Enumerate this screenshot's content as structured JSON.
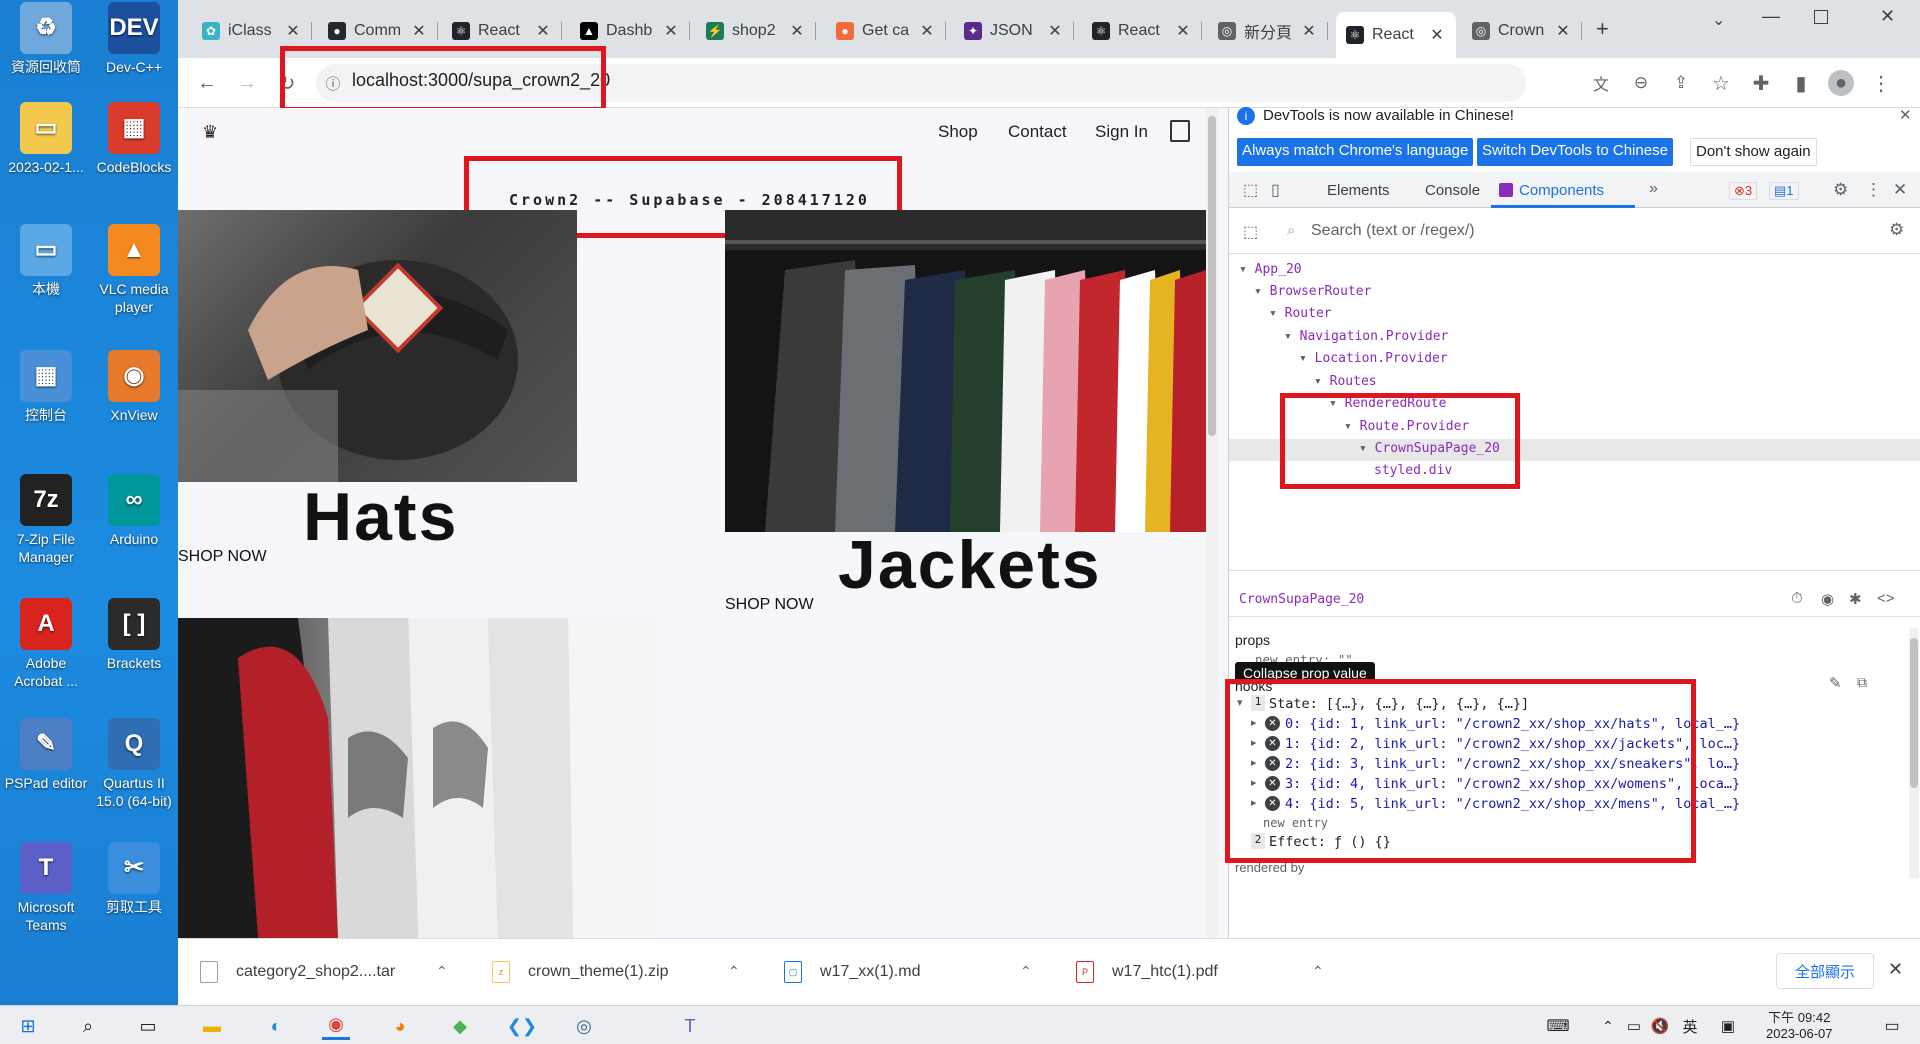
{
  "desktop": {
    "icons": [
      {
        "label": "資源回收筒",
        "glyph": "♻",
        "color": "#6fa8dc"
      },
      {
        "label": "Dev-C++",
        "glyph": "DEV",
        "color": "#1c4f9c"
      },
      {
        "label": "2023-02-1...",
        "glyph": "▭",
        "color": "#f2c94c"
      },
      {
        "label": "CodeBlocks",
        "glyph": "▦",
        "color": "#d83b2c"
      },
      {
        "label": "本機",
        "glyph": "▭",
        "color": "#5aa9e6"
      },
      {
        "label": "VLC media player",
        "glyph": "▲",
        "color": "#f48a1f"
      },
      {
        "label": "控制台",
        "glyph": "▦",
        "color": "#4a90d9"
      },
      {
        "label": "XnView",
        "glyph": "◉",
        "color": "#e7792b"
      },
      {
        "label": "7-Zip File Manager",
        "glyph": "7z",
        "color": "#222222"
      },
      {
        "label": "Arduino",
        "glyph": "∞",
        "color": "#00979c"
      },
      {
        "label": "Adobe Acrobat ...",
        "glyph": "A",
        "color": "#d9231f"
      },
      {
        "label": "Brackets",
        "glyph": "[ ]",
        "color": "#2b2b2b"
      },
      {
        "label": "PSPad editor",
        "glyph": "✎",
        "color": "#4d7fc4"
      },
      {
        "label": "Quartus II 15.0 (64-bit)",
        "glyph": "Q",
        "color": "#2f6db5"
      },
      {
        "label": "Microsoft Teams",
        "glyph": "T",
        "color": "#5b5fc7"
      },
      {
        "label": "剪取工具",
        "glyph": "✂",
        "color": "#3a8edb"
      }
    ]
  },
  "browser": {
    "tabs": [
      {
        "title": "iClass",
        "fav_color": "#3bb3c3",
        "fav_glyph": "✿"
      },
      {
        "title": "Comm",
        "fav_color": "#24292f",
        "fav_glyph": "●"
      },
      {
        "title": "React",
        "fav_color": "#20232a",
        "fav_glyph": "⚛"
      },
      {
        "title": "Dashb",
        "fav_color": "#000000",
        "fav_glyph": "▲"
      },
      {
        "title": "shop2",
        "fav_color": "#1c7c54",
        "fav_glyph": "⚡"
      },
      {
        "title": "Get ca",
        "fav_color": "#f26b3a",
        "fav_glyph": "●"
      },
      {
        "title": "JSON",
        "fav_color": "#5a2b8c",
        "fav_glyph": "✦"
      },
      {
        "title": "React",
        "fav_color": "#20232a",
        "fav_glyph": "⚛"
      },
      {
        "title": "新分頁",
        "fav_color": "#5f6368",
        "fav_glyph": "◎"
      },
      {
        "title": "React",
        "fav_color": "#20232a",
        "fav_glyph": "⚛",
        "active": true
      },
      {
        "title": "Crown",
        "fav_color": "#5f6368",
        "fav_glyph": "◎"
      }
    ],
    "url": "localhost:3000/supa_crown2_20"
  },
  "page": {
    "nav": {
      "shop": "Shop",
      "contact": "Contact",
      "signin": "Sign In"
    },
    "subtitle": "Crown2 -- Supabase - 208417120",
    "categories": [
      {
        "title": "Hats",
        "cta": "SHOP NOW"
      },
      {
        "title": "Jackets",
        "cta": "SHOP NOW"
      }
    ]
  },
  "devtools": {
    "banner": "DevTools is now available in Chinese!",
    "btn_match": "Always match Chrome's language",
    "btn_switch": "Switch DevTools to Chinese",
    "btn_dont": "Don't show again",
    "tabs": {
      "elements": "Elements",
      "console": "Console",
      "components": "Components"
    },
    "error_count": "3",
    "msg_count": "1",
    "search_placeholder": "Search (text or /regex/)",
    "tree": [
      "App_20",
      "BrowserRouter",
      "Router",
      "Navigation.Provider",
      "Location.Provider",
      "Routes",
      "RenderedRoute",
      "Route.Provider",
      "CrownSupaPage_20",
      "styled.div"
    ],
    "selected_component": "CrownSupaPage_20",
    "props_label": "props",
    "props_new_entry": "new entry: \"\"",
    "tooltip": "Collapse prop value",
    "hooks_label": "hooks",
    "state_line": "State: [{…}, {…}, {…}, {…}, {…}]",
    "state_items": [
      "0: {id: 1, link_url: \"/crown2_xx/shop_xx/hats\", local_…}",
      "1: {id: 2, link_url: \"/crown2_xx/shop_xx/jackets\", loc…}",
      "2: {id: 3, link_url: \"/crown2_xx/shop_xx/sneakers\", lo…}",
      "3: {id: 4, link_url: \"/crown2_xx/shop_xx/womens\", loca…}",
      "4: {id: 5, link_url: \"/crown2_xx/shop_xx/mens\", local_…}"
    ],
    "state_new_entry": "new entry",
    "effect_line": "Effect: ƒ () {}",
    "rendered_by": "rendered by"
  },
  "downloads": {
    "items": [
      "category2_shop2....tar",
      "crown_theme(1).zip",
      "w17_xx(1).md",
      "w17_htc(1).pdf"
    ],
    "show_all": "全部顯示"
  },
  "taskbar": {
    "ime": "英",
    "time": "下午 09:42",
    "date": "2023-06-07"
  },
  "colors": {
    "highlight": "#e0161f",
    "devtools_accent": "#1a73e8",
    "component_purple": "#8b2bb9"
  }
}
